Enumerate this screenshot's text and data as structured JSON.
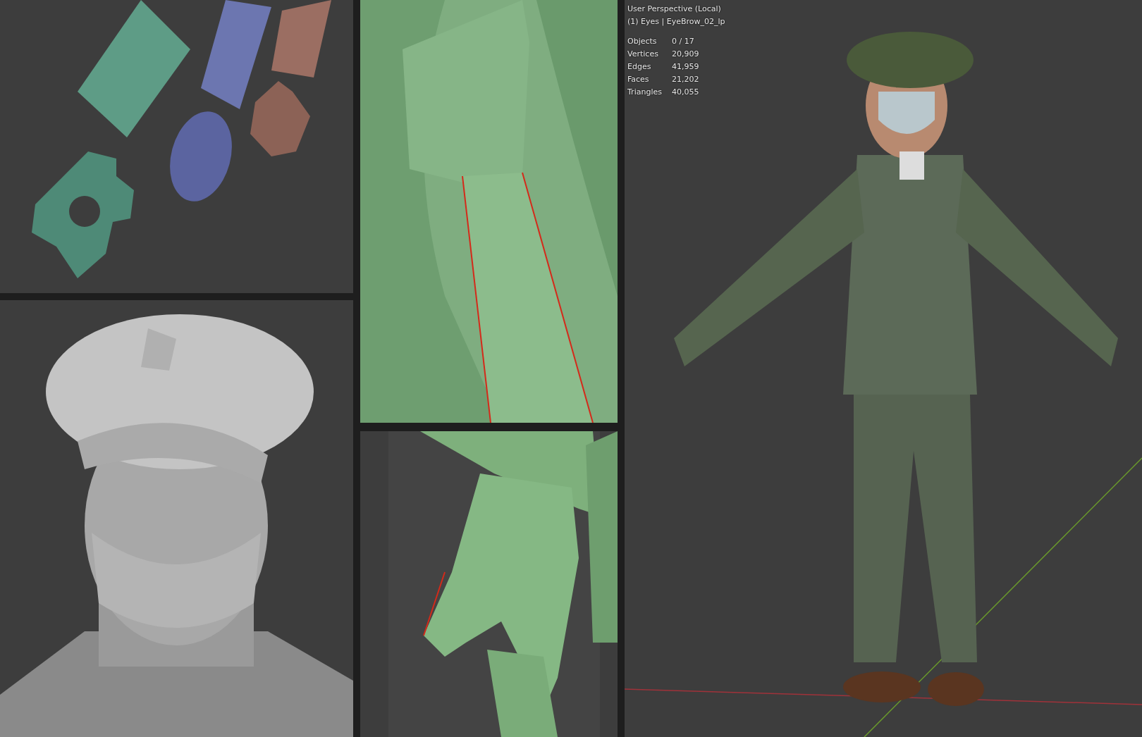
{
  "viewport": {
    "perspective": "User Perspective (Local)",
    "object": "(1) Eyes | EyeBrow_02_lp",
    "stats": [
      {
        "label": "Objects",
        "value": "0 / 17"
      },
      {
        "label": "Vertices",
        "value": "20,909"
      },
      {
        "label": "Edges",
        "value": "41,959"
      },
      {
        "label": "Faces",
        "value": "21,202"
      },
      {
        "label": "Triangles",
        "value": "40,055"
      }
    ]
  }
}
